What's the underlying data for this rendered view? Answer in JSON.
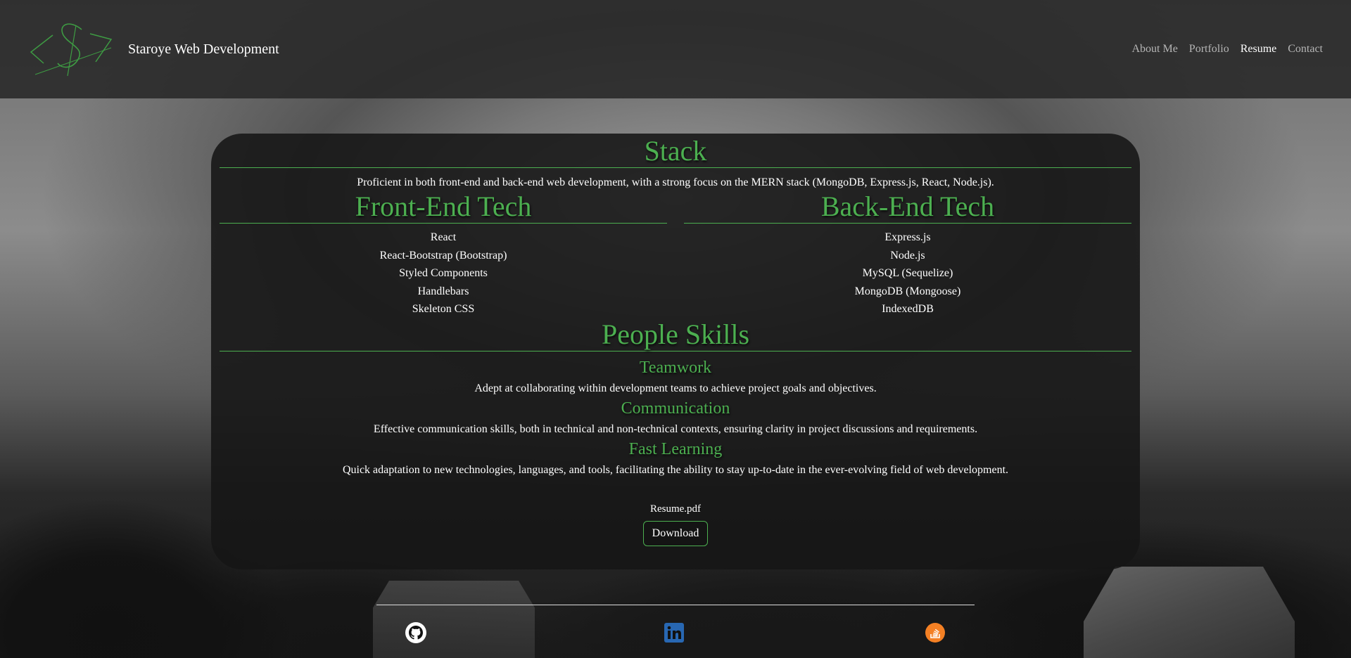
{
  "header": {
    "brand": "Staroye Web Development",
    "nav": [
      {
        "label": "About Me",
        "active": false
      },
      {
        "label": "Portfolio",
        "active": false
      },
      {
        "label": "Resume",
        "active": true
      },
      {
        "label": "Contact",
        "active": false
      }
    ]
  },
  "stack": {
    "title": "Stack",
    "description": "Proficient in both front-end and back-end web development, with a strong focus on the MERN stack (MongoDB, Express.js, React, Node.js)."
  },
  "frontend": {
    "title": "Front-End Tech",
    "items": [
      "React",
      "React-Bootstrap (Bootstrap)",
      "Styled Components",
      "Handlebars",
      "Skeleton CSS"
    ]
  },
  "backend": {
    "title": "Back-End Tech",
    "items": [
      "Express.js",
      "Node.js",
      "MySQL (Sequelize)",
      "MongoDB (Mongoose)",
      "IndexedDB"
    ]
  },
  "people": {
    "title": "People Skills",
    "skills": [
      {
        "title": "Teamwork",
        "description": "Adept at collaborating within development teams to achieve project goals and objectives."
      },
      {
        "title": "Communication",
        "description": "Effective communication skills, both in technical and non-technical contexts, ensuring clarity in project discussions and requirements."
      },
      {
        "title": "Fast Learning",
        "description": "Quick adaptation to new technologies, languages, and tools, facilitating the ability to stay up-to-date in the ever-evolving field of web development."
      }
    ]
  },
  "resume": {
    "filename": "Resume.pdf",
    "download_label": "Download"
  },
  "footer": {
    "icons": [
      "github-icon",
      "linkedin-icon",
      "stackoverflow-icon"
    ]
  },
  "colors": {
    "accent": "#4caf50",
    "linkedin": "#2867b2",
    "stackoverflow": "#f48024"
  }
}
